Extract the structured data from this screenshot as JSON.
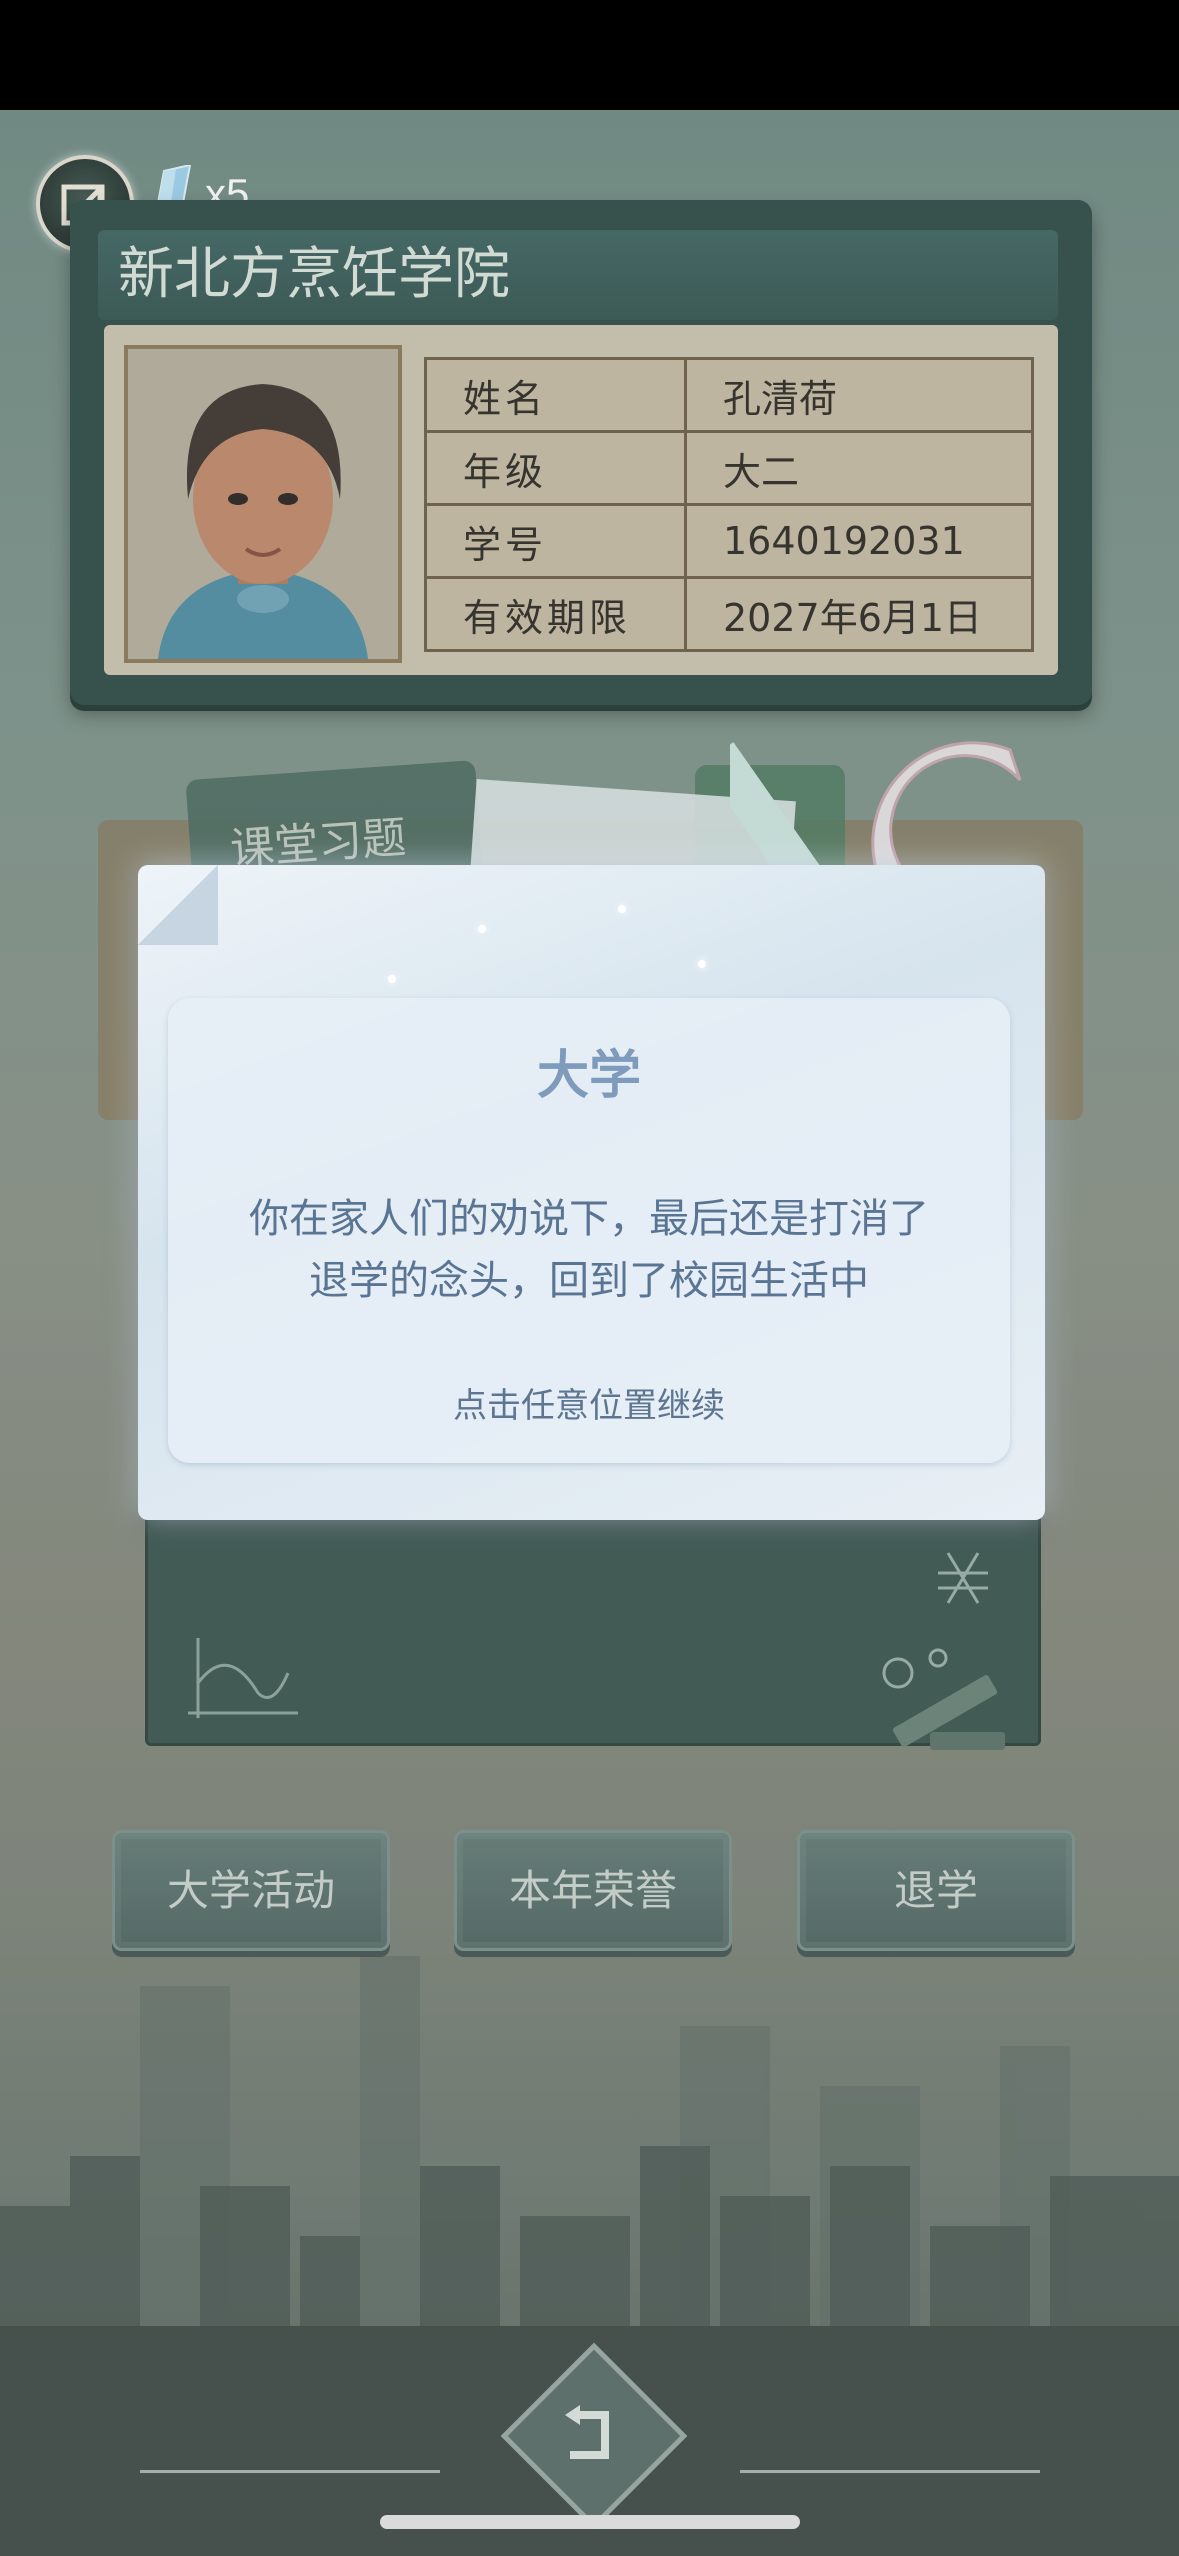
{
  "header": {
    "gem_count": "x5"
  },
  "id_card": {
    "school": "新北方烹饪学院",
    "fields": [
      {
        "key": "姓名",
        "value": "孔清荷"
      },
      {
        "key": "年级",
        "value": "大二"
      },
      {
        "key": "学号",
        "value": "1640192031"
      },
      {
        "key": "有效期限",
        "value": "2027年6月1日"
      }
    ]
  },
  "tabs": {
    "classroom_exercises": "课堂习题"
  },
  "menu": {
    "activities": "大学活动",
    "honors": "本年荣誉",
    "drop_out": "退学"
  },
  "dialog": {
    "title": "大学",
    "message_line1": "你在家人们的劝说下，最后还是打消了",
    "message_line2": "退学的念头，回到了校园生活中",
    "hint": "点击任意位置继续"
  },
  "colors": {
    "card": "#2e4a47",
    "dialog_title": "#7f9bbc",
    "dialog_text": "#5a7594"
  }
}
